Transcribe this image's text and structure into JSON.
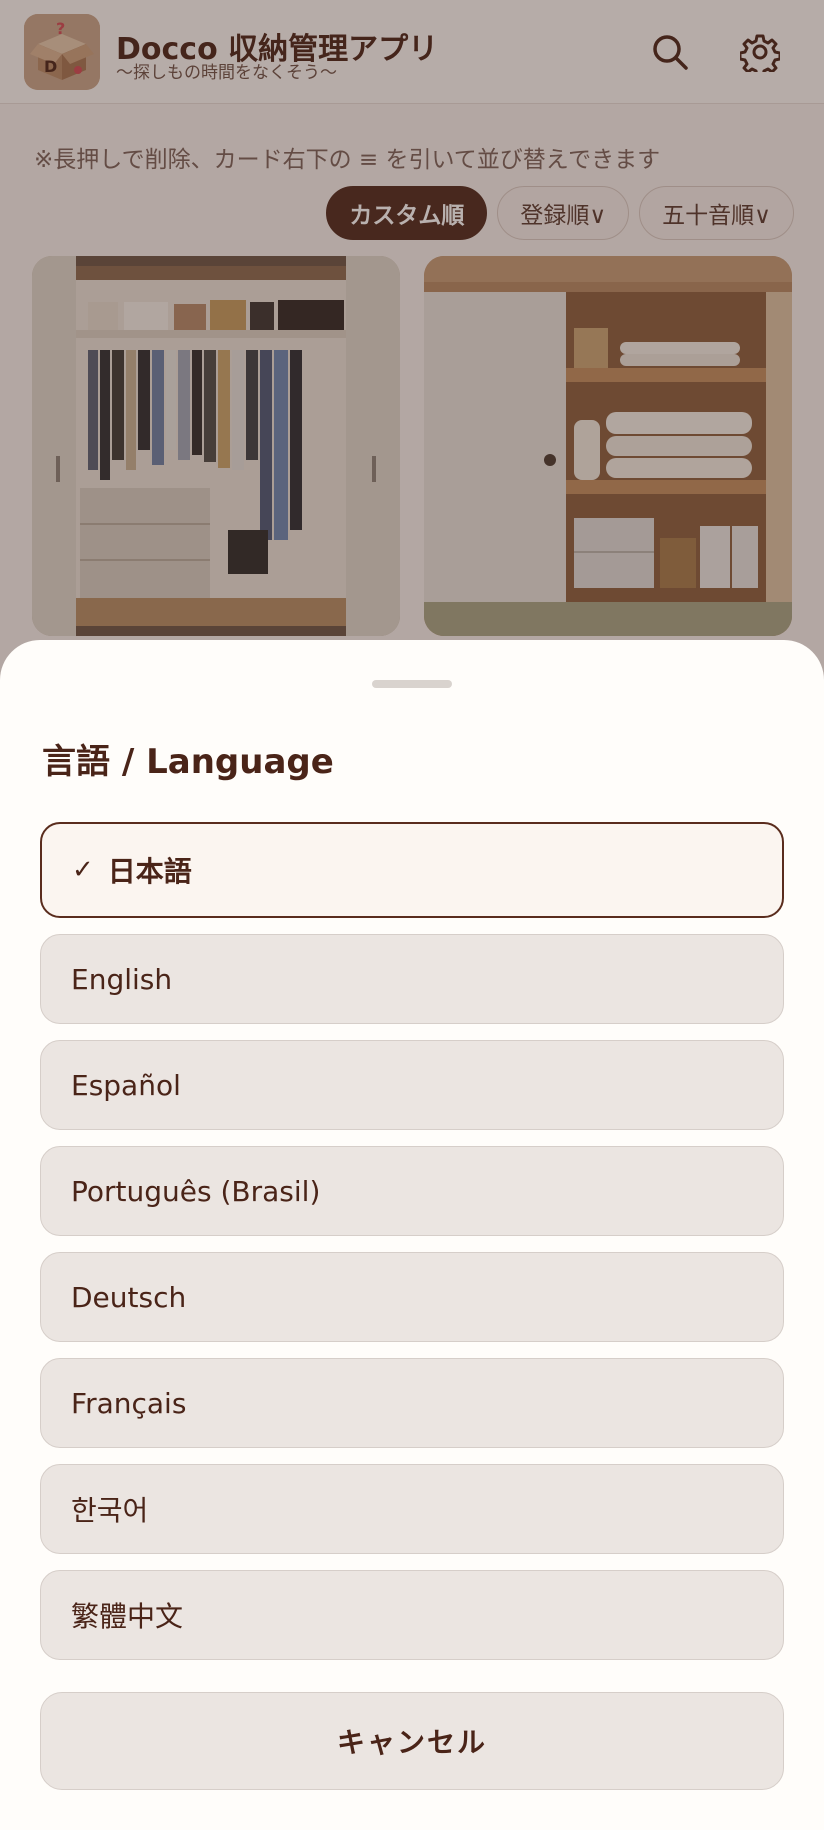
{
  "app": {
    "title": "Docco 収納管理アプリ",
    "subtitle": "〜探しもの時間をなくそう〜",
    "hint": "※長押しで削除、カード右下の ≡ を引いて並び替えできます",
    "search_icon": "search-icon",
    "settings_icon": "gear-icon"
  },
  "sort": {
    "options": [
      "カスタム順",
      "登録順∨",
      "五十音順∨"
    ],
    "active_index": 0
  },
  "sheet": {
    "title": "言語 / Language",
    "check_mark": "✓",
    "selected_index": 0,
    "languages": [
      "日本語",
      "English",
      "Español",
      "Português (Brasil)",
      "Deutsch",
      "Français",
      "한국어",
      "繁體中文"
    ],
    "cancel_label": "キャンセル"
  },
  "colors": {
    "brand_dark": "#4f2a1d",
    "sheet_bg": "#fffdfa",
    "option_bg": "#ebe5e1"
  }
}
